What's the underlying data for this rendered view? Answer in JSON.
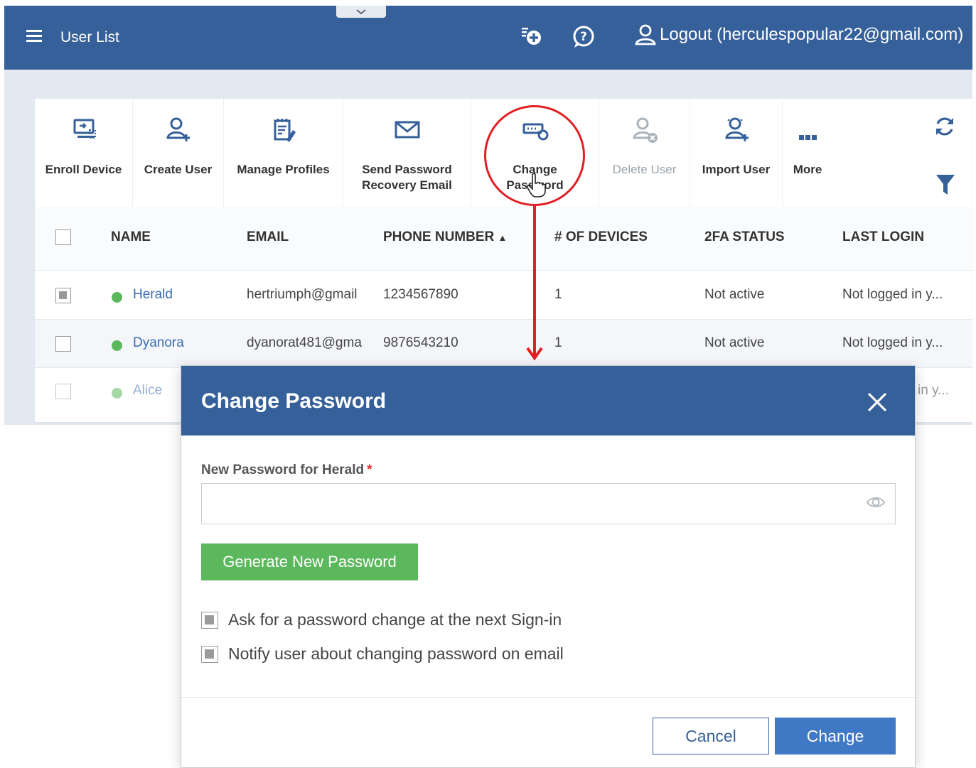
{
  "header": {
    "title": "User List",
    "logout_label": "Logout (herculespopular22@gmail.com)",
    "icons": [
      "menu-icon",
      "add-task-icon",
      "help-icon",
      "user-icon"
    ]
  },
  "toolbar": {
    "items": [
      {
        "label": "Enroll Device",
        "icon": "enroll-device-icon",
        "enabled": true
      },
      {
        "label": "Create User",
        "icon": "create-user-icon",
        "enabled": true
      },
      {
        "label": "Manage Profiles",
        "icon": "manage-profiles-icon",
        "enabled": true
      },
      {
        "label": "Send Password\nRecovery Email",
        "icon": "envelope-icon",
        "enabled": true
      },
      {
        "label": "Change\nPassword",
        "icon": "change-password-icon",
        "enabled": true
      },
      {
        "label": "Delete User",
        "icon": "delete-user-icon",
        "enabled": false
      },
      {
        "label": "Import User",
        "icon": "import-user-icon",
        "enabled": true
      },
      {
        "label": "More",
        "icon": "more-icon",
        "enabled": true
      }
    ],
    "side_icons": [
      "refresh-icon",
      "filter-icon"
    ]
  },
  "table": {
    "columns": [
      "NAME",
      "EMAIL",
      "PHONE NUMBER",
      "# OF DEVICES",
      "2FA STATUS",
      "LAST LOGIN"
    ],
    "sort_indicator": "▲",
    "rows": [
      {
        "name": "Herald",
        "email": "hertriumph@gmail",
        "phone": "1234567890",
        "devices": "1",
        "twofa": "Not active",
        "last_login": "Not logged in y...",
        "checked": true,
        "status_color": "#5cb85c"
      },
      {
        "name": "Dyanora",
        "email": "dyanorat481@gma",
        "phone": "9876543210",
        "devices": "1",
        "twofa": "Not active",
        "last_login": "Not logged in y...",
        "checked": false,
        "status_color": "#5cb85c"
      },
      {
        "name": "Alice",
        "email": "",
        "phone": "",
        "devices": "",
        "twofa": "",
        "last_login": "in y...",
        "checked": false,
        "status_color": "#5cb85c"
      }
    ]
  },
  "modal": {
    "title": "Change Password",
    "field_label": "New Password for Herald",
    "required_mark": "*",
    "password_value": "",
    "generate_label": "Generate New Password",
    "options": [
      {
        "label": "Ask for a password change at the next Sign-in",
        "checked": true
      },
      {
        "label": "Notify user about changing password on email",
        "checked": true
      }
    ],
    "cancel_label": "Cancel",
    "change_label": "Change"
  },
  "colors": {
    "header_bg": "#36609a",
    "primary_button": "#3f78c5",
    "generate_button": "#5cb85c",
    "annotation": "#e31e24",
    "status_active": "#5cb85c"
  }
}
